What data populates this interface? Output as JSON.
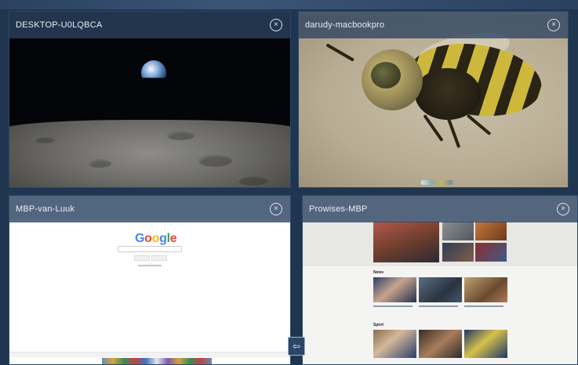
{
  "panels": [
    {
      "title": "DESKTOP-U0LQBCA"
    },
    {
      "title": "darudy-macbookpro"
    },
    {
      "title": "MBP-van-Luuk"
    },
    {
      "title": "Prowises-MBP"
    }
  ],
  "close_label": "×",
  "google_logo": "Google",
  "news": {
    "section_news": "News",
    "section_sport": "Sport"
  },
  "exit_icon": "⇦",
  "colors": {
    "background": "#1f3550",
    "titlebar": "#2b4362",
    "title_text": "#e8eef6"
  }
}
